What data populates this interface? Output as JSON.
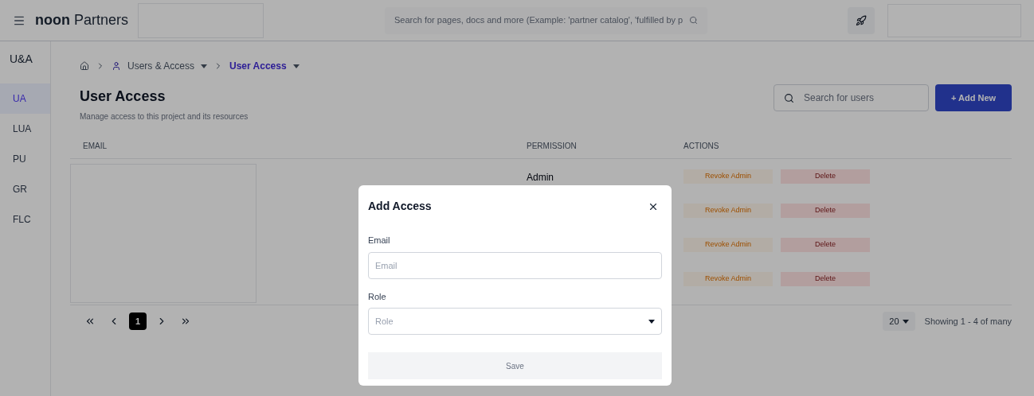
{
  "header": {
    "brand_bold": "noon",
    "brand_rest": "Partners",
    "search": {
      "placeholder": "Search for pages, docs and more (Example: 'partner catalog', 'fulfilled by p"
    }
  },
  "sidebar": {
    "title": "U&A",
    "items": [
      {
        "label": "UA",
        "selected": true
      },
      {
        "label": "LUA",
        "selected": false
      },
      {
        "label": "PU",
        "selected": false
      },
      {
        "label": "GR",
        "selected": false
      },
      {
        "label": "FLC",
        "selected": false
      }
    ]
  },
  "breadcrumb": [
    {
      "label": "Users & Access",
      "current": false
    },
    {
      "label": "User Access",
      "current": true
    }
  ],
  "page": {
    "title": "User Access",
    "subtitle": "Manage access to this project and its resources",
    "search": {
      "placeholder": "Search for users"
    },
    "add_button": "+ Add New"
  },
  "table": {
    "columns": [
      "EMAIL",
      "PERMISSION",
      "ACTIONS"
    ],
    "rows": [
      {
        "permission": "Admin",
        "actions": [
          "Revoke Admin",
          "Delete"
        ]
      },
      {
        "actions": [
          "Revoke Admin",
          "Delete"
        ]
      },
      {
        "actions": [
          "Revoke Admin",
          "Delete"
        ]
      },
      {
        "actions": [
          "Revoke Admin",
          "Delete"
        ]
      }
    ]
  },
  "pagination": {
    "pages": [
      {
        "label": "1",
        "selected": true
      }
    ],
    "page_size": "20",
    "summary": "Showing 1 - 4 of many"
  },
  "dialog": {
    "title": "Add Access",
    "fields": [
      {
        "kind": "text",
        "label": "Email",
        "placeholder": "Email"
      },
      {
        "kind": "select",
        "label": "Role",
        "placeholder": "Role"
      }
    ],
    "save": {
      "label": "Save",
      "disabled": true
    }
  }
}
